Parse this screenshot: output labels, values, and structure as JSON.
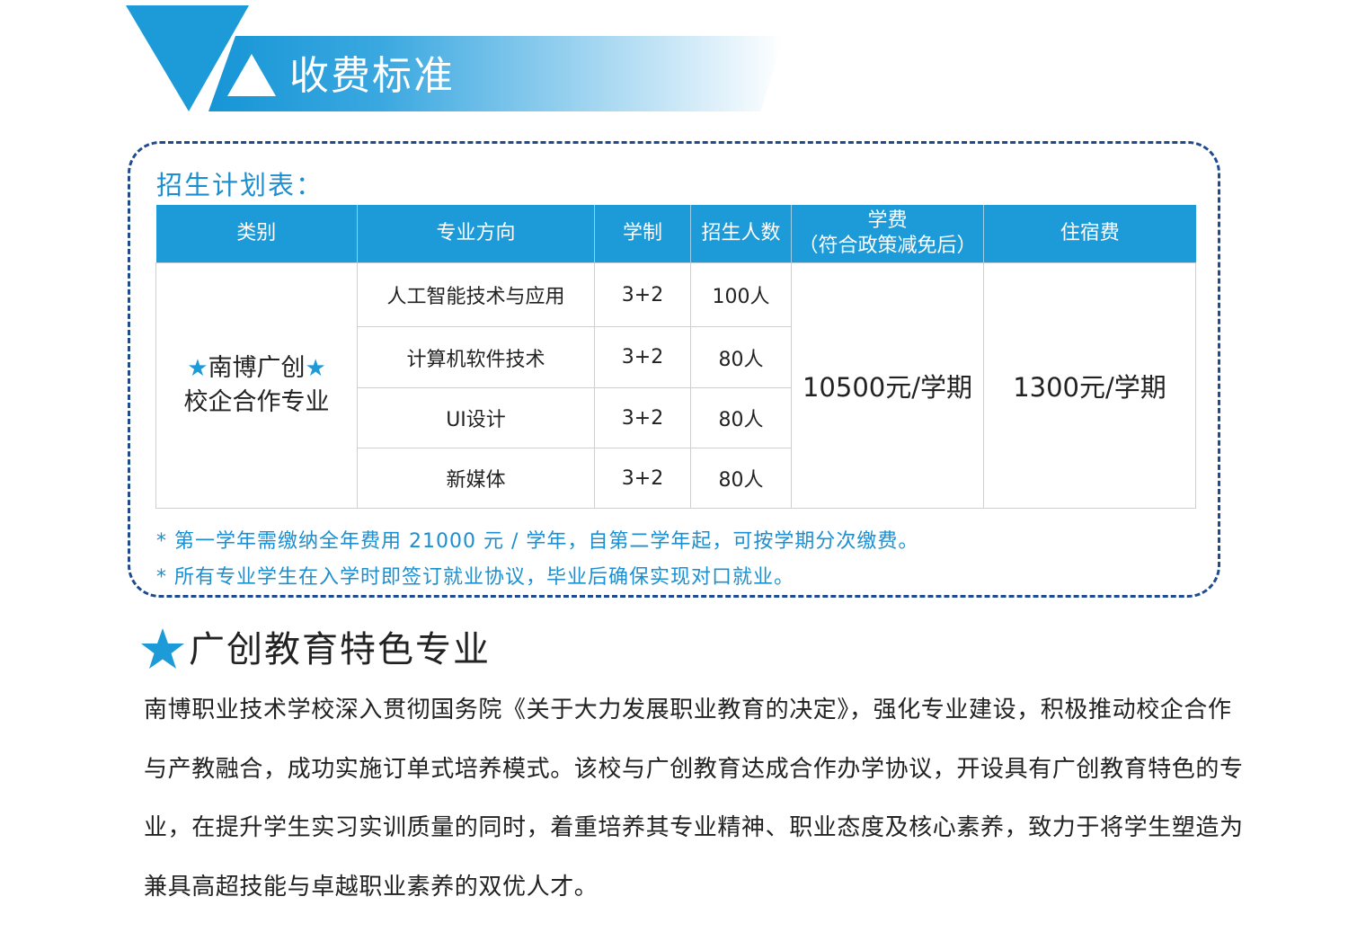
{
  "section_title": "收费标准",
  "plan": {
    "title": "招生计划表：",
    "headers": {
      "category": "类别",
      "major": "专业方向",
      "duration": "学制",
      "enroll": "招生人数",
      "tuition_line1": "学费",
      "tuition_line2": "（符合政策减免后）",
      "dorm": "住宿费"
    },
    "category_line1": "南博广创",
    "category_line2": "校企合作专业",
    "rows": [
      {
        "major": "人工智能技术与应用",
        "duration": "3+2",
        "enroll": "100人"
      },
      {
        "major": "计算机软件技术",
        "duration": "3+2",
        "enroll": "80人"
      },
      {
        "major": "UI设计",
        "duration": "3+2",
        "enroll": "80人"
      },
      {
        "major": "新媒体",
        "duration": "3+2",
        "enroll": "80人"
      }
    ],
    "tuition": "10500元/学期",
    "dorm_fee": "1300元/学期"
  },
  "notes": [
    "* 第一学年需缴纳全年费用 21000 元 / 学年，自第二学年起，可按学期分次缴费。",
    "* 所有专业学生在入学时即签订就业协议，毕业后确保实现对口就业。"
  ],
  "featured": {
    "title": "广创教育特色专业",
    "paragraph": "南博职业技术学校深入贯彻国务院《关于大力发展职业教育的决定》，强化专业建设，积极推动校企合作与产教融合，成功实施订单式培养模式。该校与广创教育达成合作办学协议，开设具有广创教育特色的专业，在提升学生实习实训质量的同时，着重培养其专业精神、职业态度及核心素养，致力于将学生塑造为兼具高超技能与卓越职业素养的双优人才。"
  },
  "colors": {
    "accent": "#1d9ad8",
    "note_text": "#1c8fd0",
    "dash_border": "#1f4a8f"
  }
}
